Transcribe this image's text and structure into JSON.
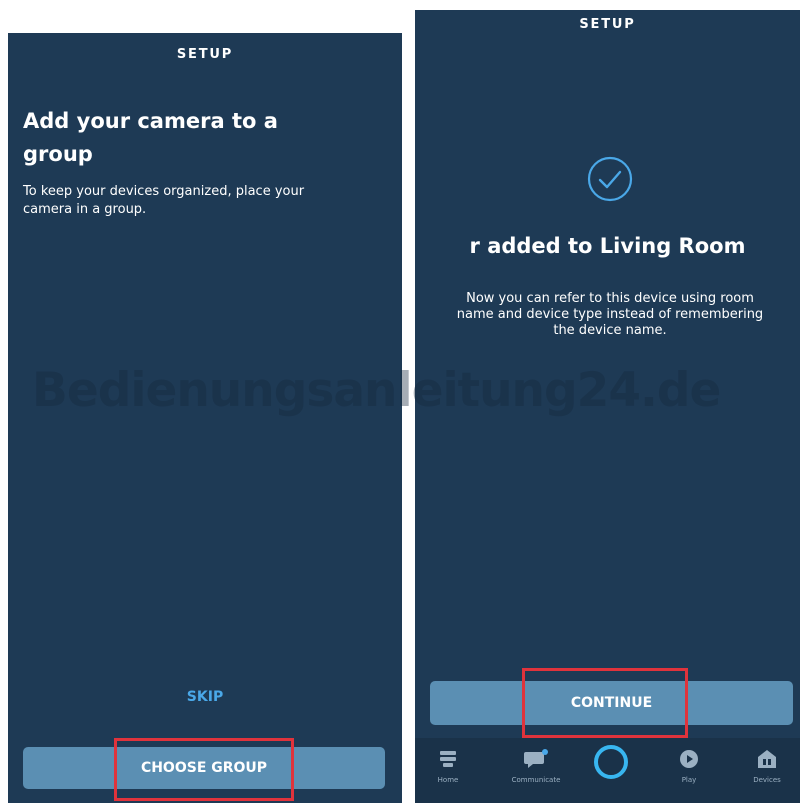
{
  "left_screen": {
    "header_title": "SETUP",
    "heading": "Add your camera to a group",
    "description": "To keep your devices organized, place your camera in a group.",
    "skip_label": "SKIP",
    "choose_group_label": "CHOOSE GROUP"
  },
  "right_screen": {
    "header_title": "SETUP",
    "heading": "r added to Living Room",
    "description": "Now you can refer to this device using room name and device type instead of remembering the device name.",
    "continue_label": "CONTINUE",
    "tabs": [
      {
        "label": "Home",
        "icon": "home-icon"
      },
      {
        "label": "Communicate",
        "icon": "chat-bubble-icon"
      },
      {
        "label": "",
        "icon": "alexa-ring-icon"
      },
      {
        "label": "Play",
        "icon": "play-icon"
      },
      {
        "label": "Devices",
        "icon": "devices-icon"
      }
    ]
  },
  "watermark": "Bedienungsanleitung24.de",
  "colors": {
    "screen_bg": "#1e3a55",
    "button_bg": "#5b8fb3",
    "accent": "#4aa8e8",
    "highlight": "#e0333c"
  }
}
